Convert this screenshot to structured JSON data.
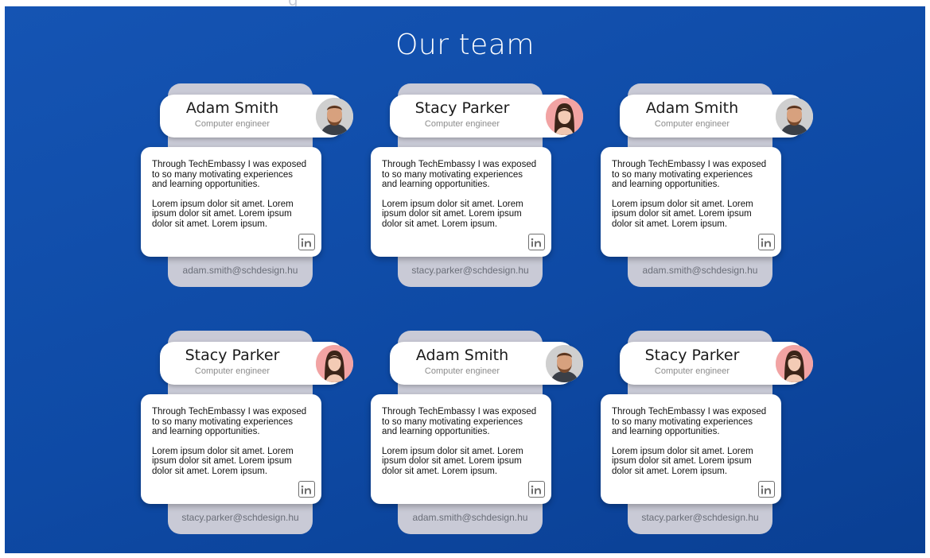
{
  "page": {
    "title": "Our team",
    "clipped_heading_fragment": "g"
  },
  "team": [
    {
      "name": "Adam Smith",
      "role": "Computer engineer",
      "avatar": "male-avatar",
      "bio_p1": "Through TechEmbassy I was exposed to so many motivating experiences and learning opportunities.",
      "bio_p2": "Lorem ipsum dolor sit amet. Lorem ipsum dolor sit amet. Lorem ipsum dolor sit amet. Lorem ipsum.",
      "email": "adam.smith@schdesign.hu"
    },
    {
      "name": "Stacy Parker",
      "role": "Computer engineer",
      "avatar": "female-avatar",
      "bio_p1": "Through TechEmbassy I was exposed to so many motivating experiences and learning opportunities.",
      "bio_p2": "Lorem ipsum dolor sit amet. Lorem ipsum dolor sit amet. Lorem ipsum dolor sit amet. Lorem ipsum.",
      "email": "stacy.parker@schdesign.hu"
    },
    {
      "name": "Adam Smith",
      "role": "Computer engineer",
      "avatar": "male-avatar",
      "bio_p1": "Through TechEmbassy I was exposed to so many motivating experiences and learning opportunities.",
      "bio_p2": "Lorem ipsum dolor sit amet. Lorem ipsum dolor sit amet. Lorem ipsum dolor sit amet. Lorem ipsum.",
      "email": "adam.smith@schdesign.hu"
    },
    {
      "name": "Stacy Parker",
      "role": "Computer engineer",
      "avatar": "female-avatar",
      "bio_p1": "Through TechEmbassy I was exposed to so many motivating experiences and learning opportunities.",
      "bio_p2": "Lorem ipsum dolor sit amet. Lorem ipsum dolor sit amet. Lorem ipsum dolor sit amet. Lorem ipsum.",
      "email": "stacy.parker@schdesign.hu"
    },
    {
      "name": "Adam Smith",
      "role": "Computer engineer",
      "avatar": "male-avatar",
      "bio_p1": "Through TechEmbassy I was exposed to so many motivating experiences and learning opportunities.",
      "bio_p2": "Lorem ipsum dolor sit amet. Lorem ipsum dolor sit amet. Lorem ipsum dolor sit amet. Lorem ipsum.",
      "email": "adam.smith@schdesign.hu"
    },
    {
      "name": "Stacy Parker",
      "role": "Computer engineer",
      "avatar": "female-avatar",
      "bio_p1": "Through TechEmbassy I was exposed to so many motivating experiences and learning opportunities.",
      "bio_p2": "Lorem ipsum dolor sit amet. Lorem ipsum dolor sit amet. Lorem ipsum dolor sit amet. Lorem ipsum.",
      "email": "stacy.parker@schdesign.hu"
    }
  ],
  "icons": {
    "linkedin": "linkedin-icon"
  },
  "colors": {
    "background": "#0e4aa5",
    "card_back": "#c9cad6",
    "card_front": "#ffffff"
  }
}
